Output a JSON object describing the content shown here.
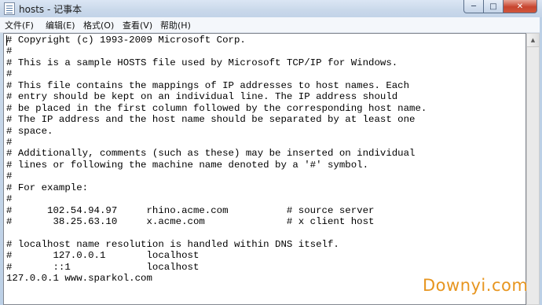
{
  "window": {
    "title": "hosts - 记事本",
    "controls": {
      "minimize": "─",
      "maximize": "□",
      "close": "✕"
    }
  },
  "menu": {
    "items": [
      "文件(F)",
      "编辑(E)",
      "格式(O)",
      "查看(V)",
      "帮助(H)"
    ]
  },
  "editor": {
    "lines": [
      "# Copyright (c) 1993-2009 Microsoft Corp.",
      "#",
      "# This is a sample HOSTS file used by Microsoft TCP/IP for Windows.",
      "#",
      "# This file contains the mappings of IP addresses to host names. Each",
      "# entry should be kept on an individual line. The IP address should",
      "# be placed in the first column followed by the corresponding host name.",
      "# The IP address and the host name should be separated by at least one",
      "# space.",
      "#",
      "# Additionally, comments (such as these) may be inserted on individual",
      "# lines or following the machine name denoted by a '#' symbol.",
      "#",
      "# For example:",
      "#",
      "#      102.54.94.97     rhino.acme.com          # source server",
      "#       38.25.63.10     x.acme.com              # x client host",
      "",
      "# localhost name resolution is handled within DNS itself.",
      "#       127.0.0.1       localhost",
      "#       ::1             localhost",
      "127.0.0.1 www.sparkol.com"
    ]
  },
  "watermark": {
    "text": "Downyi.com",
    "color": "#e7951f"
  },
  "colors": {
    "titlebar": "#c9d8ea",
    "close_button": "#c7452f"
  }
}
